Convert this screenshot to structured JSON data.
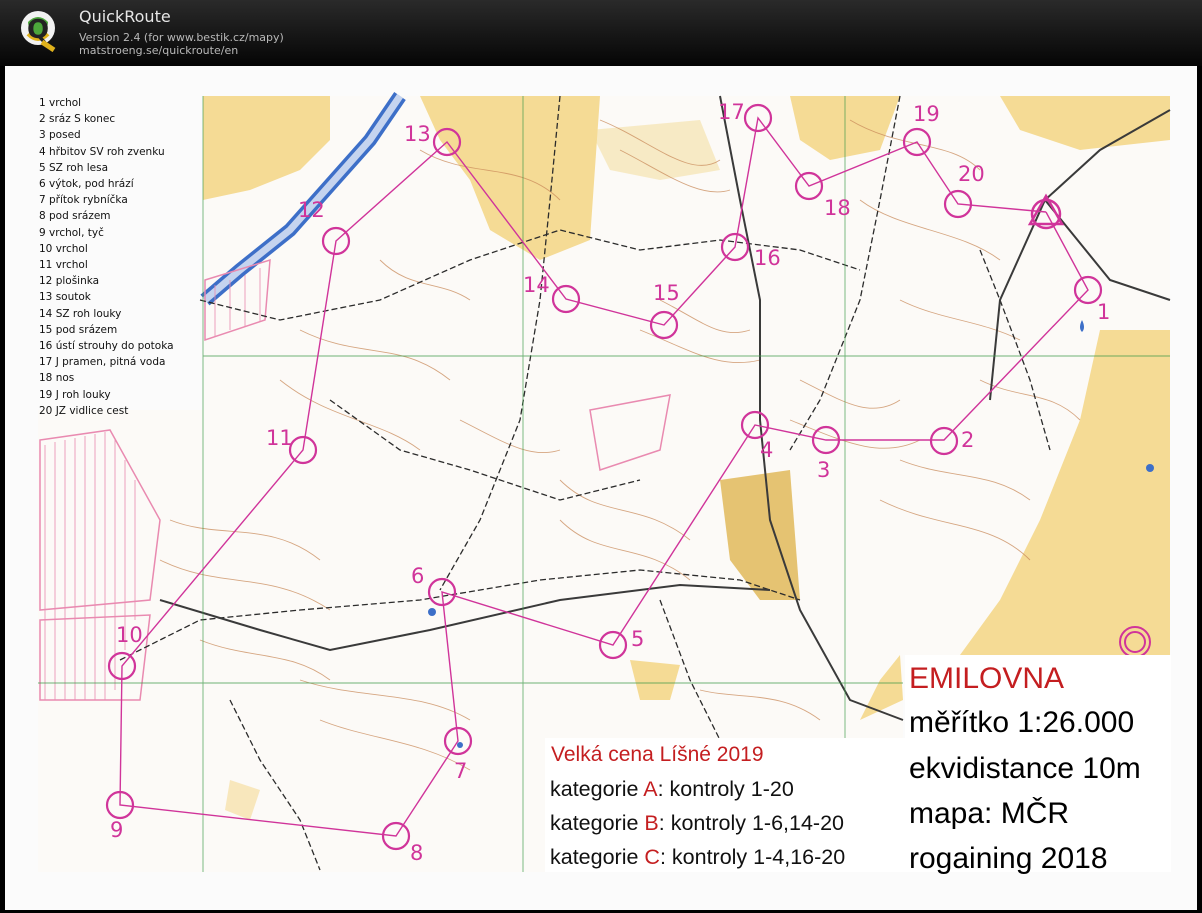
{
  "window": {
    "app_name": "QuickRoute",
    "version": "Version 2.4  (for www.bestik.cz/mapy)",
    "url": "matstroeng.se/quickroute/en",
    "logo_letter": "Q"
  },
  "legend": [
    "1 vrchol",
    "2 sráz S konec",
    "3 posed",
    "4 hřbitov SV roh zvenku",
    "5 SZ roh lesa",
    "6 výtok, pod hrází",
    "7 přítok rybníčka",
    "8 pod srázem",
    "9 vrchol, tyč",
    "10 vrchol",
    "11 vrchol",
    "12 plošinka",
    "13 soutok",
    "14 SZ roh louky",
    "15 pod srázem",
    "16 ústí strouhy do potoka",
    "17 J pramen, pitná voda",
    "18 nos",
    "19 J roh louky",
    "20 JZ vidlice cest"
  ],
  "controls": [
    "1",
    "2",
    "3",
    "4",
    "5",
    "6",
    "7",
    "8",
    "9",
    "10",
    "11",
    "12",
    "13",
    "14",
    "15",
    "16",
    "17",
    "18",
    "19",
    "20"
  ],
  "race": {
    "title": "Velká cena Líšné 2019",
    "categories": [
      {
        "prefix": "kategorie ",
        "letter": "A",
        "suffix": ": kontroly 1-20"
      },
      {
        "prefix": "kategorie ",
        "letter": "B",
        "suffix": ": kontroly 1-6,14-20"
      },
      {
        "prefix": "kategorie ",
        "letter": "C",
        "suffix": ": kontroly 1-4,16-20"
      }
    ]
  },
  "map_info": {
    "name": "EMILOVNA",
    "lines": [
      "měřítko 1:26.000",
      "ekvidistance 10m",
      "mapa: MČR",
      "rogaining 2018"
    ]
  },
  "colors": {
    "course": "#d0349a",
    "title_red": "#c41e20",
    "field_yellow": "#f4d78a",
    "contour_brown": "#c98a5a",
    "water_blue": "#3d6fc8",
    "grid_green": "#3f9a4a"
  }
}
